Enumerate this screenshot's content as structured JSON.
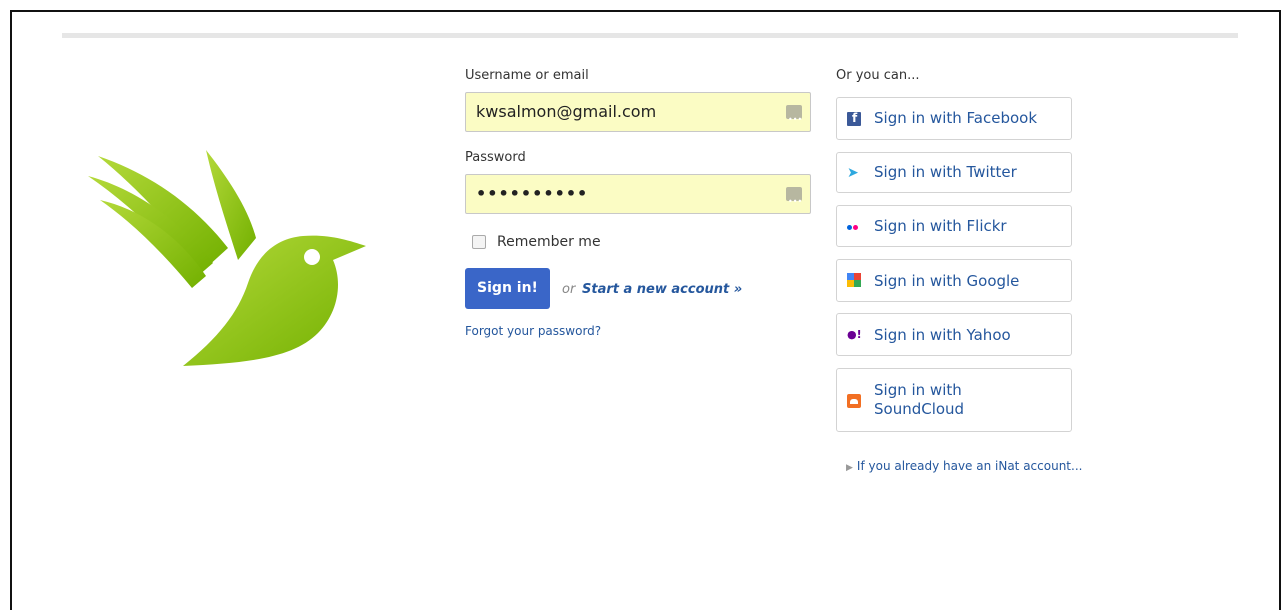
{
  "form": {
    "username_label": "Username or email",
    "username_value": "kwsalmon@gmail.com",
    "password_label": "Password",
    "password_mask": "••••••••••",
    "remember_label": "Remember me",
    "signin_label": "Sign in!",
    "or_text": "or",
    "new_account_label": "Start a new account »",
    "forgot_label": "Forgot your password?"
  },
  "social": {
    "heading": "Or you can...",
    "buttons": [
      {
        "label": "Sign in with Facebook",
        "icon": "facebook-icon"
      },
      {
        "label": "Sign in with Twitter",
        "icon": "twitter-icon"
      },
      {
        "label": "Sign in with Flickr",
        "icon": "flickr-icon"
      },
      {
        "label": "Sign in with Google",
        "icon": "google-icon"
      },
      {
        "label": "Sign in with Yahoo",
        "icon": "yahoo-icon"
      },
      {
        "label": "Sign in with SoundCloud",
        "icon": "soundcloud-icon"
      }
    ],
    "soundcloud_line1": "Sign in with",
    "soundcloud_line2": "SoundCloud",
    "already_label": "If you already have an iNat account..."
  },
  "colors": {
    "brand_green": "#8cc63f",
    "link_blue": "#25579d",
    "button_blue": "#3a66c8",
    "autofill_yellow": "#fbfcc4"
  }
}
